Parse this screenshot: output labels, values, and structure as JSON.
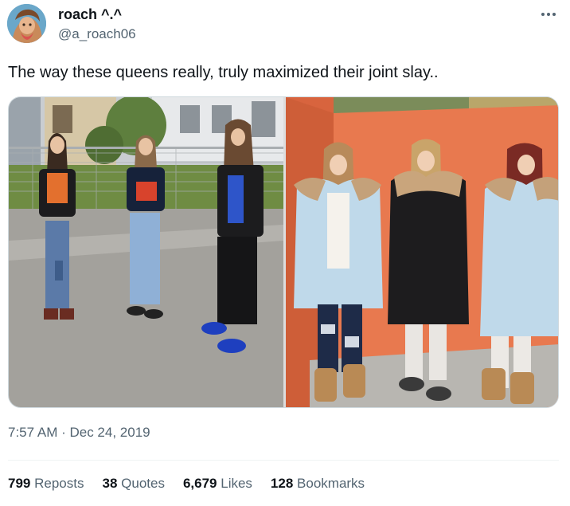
{
  "author": {
    "name": "roach ^.^",
    "handle": "@a_roach06"
  },
  "tweet": {
    "text": "The way these queens really, truly maximized their joint slay..",
    "timestamp": "7:57 AM · Dec 24, 2019"
  },
  "stats": {
    "reposts": {
      "count": "799",
      "label": "Reposts"
    },
    "quotes": {
      "count": "38",
      "label": "Quotes"
    },
    "likes": {
      "count": "6,679",
      "label": "Likes"
    },
    "bookmarks": {
      "count": "128",
      "label": "Bookmarks"
    }
  },
  "icons": {
    "more": "more-options-icon"
  },
  "colors": {
    "text_primary": "#0f1419",
    "text_secondary": "#536471",
    "border": "#cfd9de"
  }
}
